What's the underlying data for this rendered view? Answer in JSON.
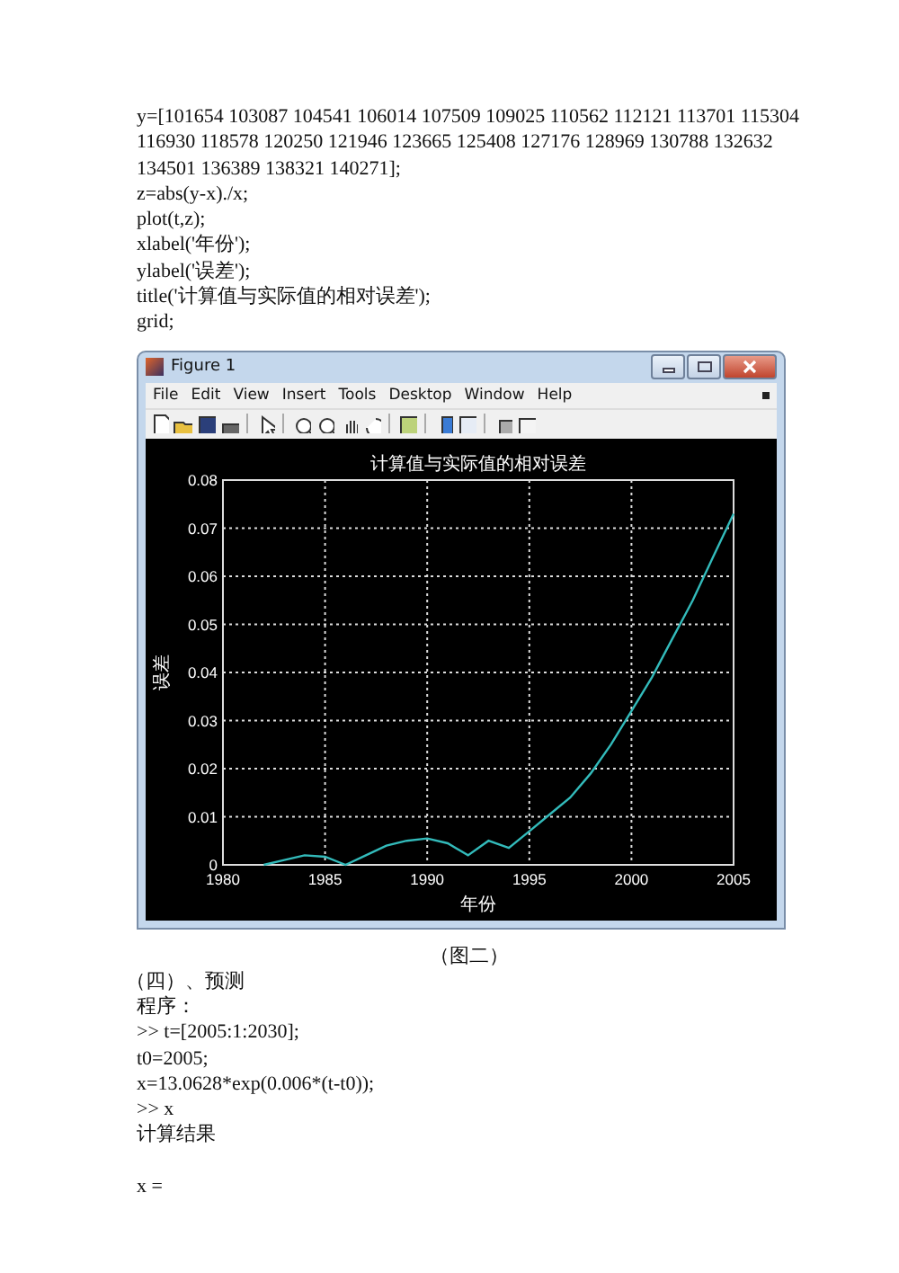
{
  "code_top": [
    "y=[101654 103087 104541 106014 107509 109025 110562 112121 113701 115304",
    "116930 118578 120250 121946 123665 125408 127176 128969 130788 132632",
    "134501 136389 138321 140271];",
    "z=abs(y-x)./x;",
    "plot(t,z);",
    "xlabel('年份');",
    "ylabel('误差');",
    "title('计算值与实际值的相对误差');",
    "grid;"
  ],
  "figure_window": {
    "title": "Figure 1",
    "menu": [
      "File",
      "Edit",
      "View",
      "Insert",
      "Tools",
      "Desktop",
      "Window",
      "Help"
    ],
    "chart_data": {
      "type": "line",
      "title": "计算值与实际值的相对误差",
      "xlabel": "年份",
      "ylabel": "误差",
      "x": [
        1982,
        1983,
        1984,
        1985,
        1986,
        1987,
        1988,
        1989,
        1990,
        1991,
        1992,
        1993,
        1994,
        1995,
        1996,
        1997,
        1998,
        1999,
        2000,
        2001,
        2002,
        2003,
        2004,
        2005
      ],
      "grid": true,
      "series": [
        {
          "color": "#33bbbb",
          "values": [
            0,
            0.001,
            0.002,
            0.0017,
            0,
            0.002,
            0.004,
            0.005,
            0.0055,
            0.0045,
            0.002,
            0.005,
            0.0035,
            0.007,
            0.0105,
            0.014,
            0.019,
            0.025,
            0.032,
            0.039,
            0.047,
            0.055,
            0.064,
            0.073
          ]
        }
      ],
      "xlim": [
        1980,
        2005
      ],
      "ylim": [
        0,
        0.08
      ],
      "xticks": [
        1980,
        1985,
        1990,
        1995,
        2000,
        2005
      ],
      "yticks": [
        {
          "value": 0,
          "label": "0"
        },
        {
          "value": 0.01,
          "label": "0.01"
        },
        {
          "value": 0.02,
          "label": "0.02"
        },
        {
          "value": 0.03,
          "label": "0.03"
        },
        {
          "value": 0.04,
          "label": "0.04"
        },
        {
          "value": 0.05,
          "label": "0.05"
        },
        {
          "value": 0.06,
          "label": "0.06"
        },
        {
          "value": 0.07,
          "label": "0.07"
        },
        {
          "value": 0.08,
          "label": "0.08"
        }
      ]
    }
  },
  "caption": "（图二）",
  "section_heading": "（四）、预测",
  "code_bottom": [
    "程序：",
    ">> t=[2005:1:2030];",
    "t0=2005;",
    "x=13.0628*exp(0.006*(t-t0));",
    ">> x",
    "计算结果"
  ],
  "result_label": "x ="
}
